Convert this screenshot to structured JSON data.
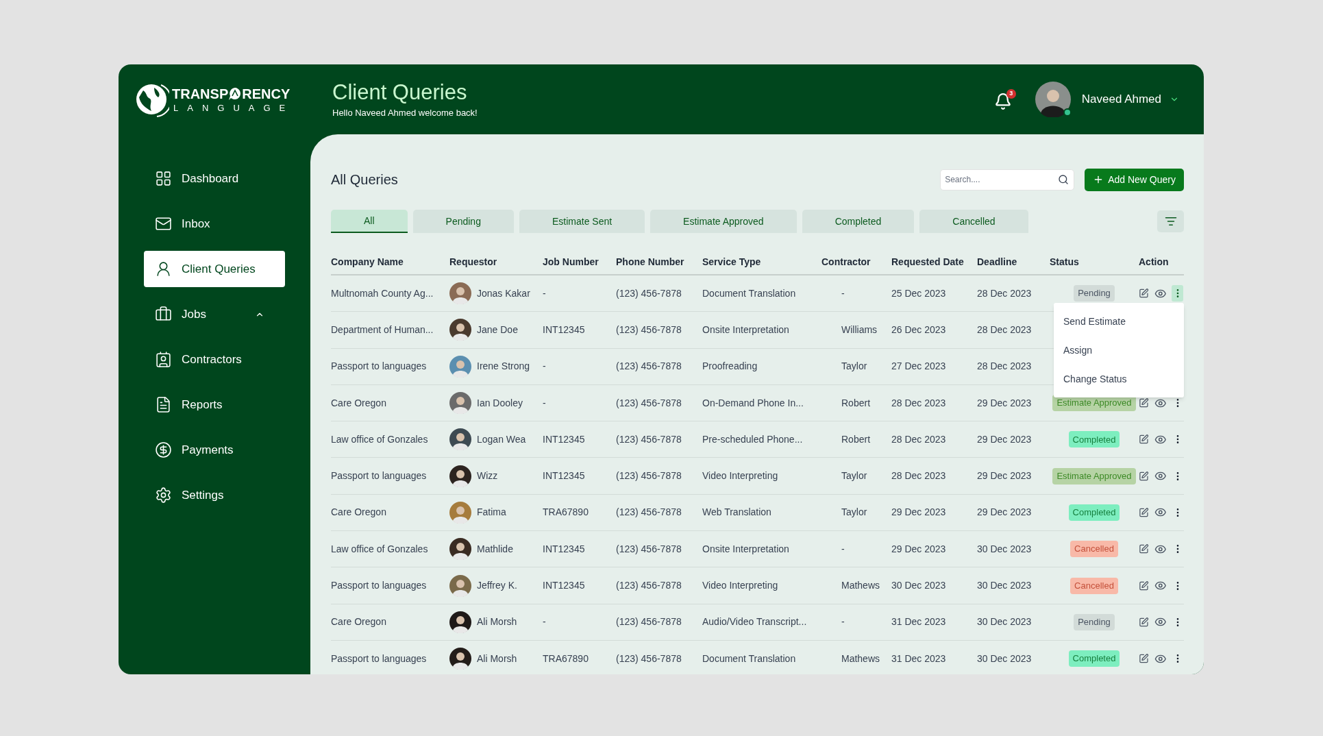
{
  "logo": {
    "word_start": "TRANSP",
    "word_end": "RENCY",
    "tagline": "LANGUAGE"
  },
  "header": {
    "title": "Client Queries",
    "subtitle": "Hello Naveed Ahmed welcome back!",
    "notification_count": "3",
    "user": {
      "name": "Naveed Ahmed",
      "online": true
    }
  },
  "sidebar": {
    "items": [
      {
        "kind": "dashboard",
        "label": "Dashboard",
        "selected": false
      },
      {
        "kind": "inbox",
        "label": "Inbox",
        "selected": false
      },
      {
        "kind": "queries",
        "label": "Client Queries",
        "selected": true
      },
      {
        "kind": "jobs",
        "label": "Jobs",
        "selected": false,
        "expanded": true
      },
      {
        "kind": "contractors",
        "label": "Contractors",
        "selected": false
      },
      {
        "kind": "reports",
        "label": "Reports",
        "selected": false
      },
      {
        "kind": "payments",
        "label": "Payments",
        "selected": false
      },
      {
        "kind": "settings",
        "label": "Settings",
        "selected": false
      }
    ]
  },
  "content": {
    "title": "All Queries",
    "search": {
      "placeholder": "Search...."
    },
    "add_button": "Add New Query",
    "tabs": [
      {
        "label": "All",
        "selected": true
      },
      {
        "label": "Pending",
        "selected": false
      },
      {
        "label": "Estimate Sent",
        "selected": false
      },
      {
        "label": "Estimate Approved",
        "selected": false
      },
      {
        "label": "Completed",
        "selected": false
      },
      {
        "label": "Cancelled",
        "selected": false
      }
    ],
    "table": {
      "columns": [
        "Company Name",
        "Requestor",
        "Job Number",
        "Phone Number",
        "Service Type",
        "Contractor",
        "Requested Date",
        "Deadline",
        "Status",
        "Action"
      ],
      "rows": [
        {
          "company": "Multnomah County Ag...",
          "requestor": "Jonas Kakar",
          "job": "-",
          "phone": "(123) 456-7878",
          "service": "Document Translation",
          "contractor": "-",
          "requested": "25 Dec 2023",
          "deadline": "28 Dec 2023",
          "status": {
            "kind": "pending",
            "label": "Pending"
          },
          "menu_open": true
        },
        {
          "company": "Department of Human...",
          "requestor": "Jane Doe",
          "job": "INT12345",
          "phone": "(123) 456-7878",
          "service": "Onsite Interpretation",
          "contractor": "Williams",
          "requested": "26 Dec 2023",
          "deadline": "28 Dec 2023",
          "menu_open": false
        },
        {
          "company": "Passport to languages",
          "requestor": "Irene Strong",
          "job": "-",
          "phone": "(123) 456-7878",
          "service": "Proofreading",
          "contractor": "Taylor",
          "requested": "27 Dec 2023",
          "deadline": "28 Dec 2023",
          "menu_open": false
        },
        {
          "company": "Care Oregon",
          "requestor": "Ian Dooley",
          "job": "-",
          "phone": "(123) 456-7878",
          "service": "On-Demand Phone In...",
          "contractor": "Robert",
          "requested": "28 Dec 2023",
          "deadline": "29 Dec 2023",
          "status": {
            "kind": "approved",
            "label": "Estimate Approved"
          },
          "menu_open": false
        },
        {
          "company": "Law office of Gonzales",
          "requestor": "Logan Wea",
          "job": "INT12345",
          "phone": "(123) 456-7878",
          "service": "Pre-scheduled Phone...",
          "contractor": "Robert",
          "requested": "28 Dec 2023",
          "deadline": "29 Dec 2023",
          "status": {
            "kind": "completed",
            "label": "Completed"
          },
          "menu_open": false
        },
        {
          "company": "Passport to languages",
          "requestor": "Wizz",
          "job": "INT12345",
          "phone": "(123) 456-7878",
          "service": "Video Interpreting",
          "contractor": "Taylor",
          "requested": "28 Dec 2023",
          "deadline": "29 Dec 2023",
          "status": {
            "kind": "approved",
            "label": "Estimate Approved"
          },
          "menu_open": false
        },
        {
          "company": "Care Oregon",
          "requestor": "Fatima",
          "job": "TRA67890",
          "phone": "(123) 456-7878",
          "service": "Web Translation",
          "contractor": "Taylor",
          "requested": "29 Dec 2023",
          "deadline": "29 Dec 2023",
          "status": {
            "kind": "completed",
            "label": "Completed"
          },
          "menu_open": false
        },
        {
          "company": "Law office of Gonzales",
          "requestor": "Mathlide",
          "job": "INT12345",
          "phone": "(123) 456-7878",
          "service": "Onsite Interpretation",
          "contractor": "-",
          "requested": "29 Dec 2023",
          "deadline": "30 Dec 2023",
          "status": {
            "kind": "cancelled",
            "label": "Cancelled"
          },
          "menu_open": false
        },
        {
          "company": "Passport to languages",
          "requestor": "Jeffrey K.",
          "job": "INT12345",
          "phone": "(123) 456-7878",
          "service": "Video Interpreting",
          "contractor": "Mathews",
          "requested": "30 Dec 2023",
          "deadline": "30 Dec 2023",
          "status": {
            "kind": "cancelled",
            "label": "Cancelled"
          },
          "menu_open": false
        },
        {
          "company": "Care Oregon",
          "requestor": "Ali Morsh",
          "job": "-",
          "phone": "(123) 456-7878",
          "service": "Audio/Video Transcript...",
          "contractor": "-",
          "requested": "31 Dec 2023",
          "deadline": "30 Dec 2023",
          "status": {
            "kind": "pending",
            "label": "Pending"
          },
          "menu_open": false
        },
        {
          "company": "Passport to languages",
          "requestor": "Ali Morsh",
          "job": "TRA67890",
          "phone": "(123) 456-7878",
          "service": "Document Translation",
          "contractor": "Mathews",
          "requested": "31 Dec 2023",
          "deadline": "30 Dec 2023",
          "status": {
            "kind": "completed",
            "label": "Completed"
          },
          "menu_open": false
        }
      ]
    },
    "row_menu": {
      "items": [
        "Send Estimate",
        "Assign",
        "Change Status"
      ]
    }
  }
}
